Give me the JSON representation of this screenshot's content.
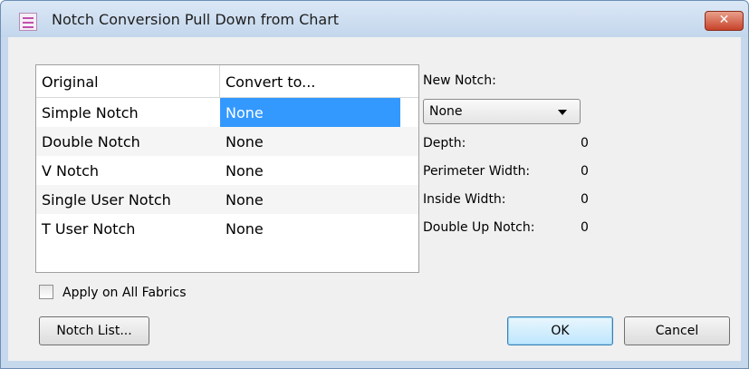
{
  "window": {
    "title": "Notch Conversion Pull Down from Chart",
    "close_label": "✕"
  },
  "grid": {
    "headers": [
      "Original",
      "Convert to..."
    ],
    "rows": [
      {
        "original": "Simple Notch",
        "convert_to": "None"
      },
      {
        "original": "Double Notch",
        "convert_to": "None"
      },
      {
        "original": "V Notch",
        "convert_to": "None"
      },
      {
        "original": "Single User Notch",
        "convert_to": "None"
      },
      {
        "original": "T User Notch",
        "convert_to": "None"
      }
    ]
  },
  "new_notch": {
    "label": "New Notch:",
    "selected": "None",
    "properties": [
      {
        "label": "Depth:",
        "value": "0"
      },
      {
        "label": "Perimeter Width:",
        "value": "0"
      },
      {
        "label": "Inside Width:",
        "value": "0"
      },
      {
        "label": "Double Up Notch:",
        "value": "0"
      }
    ]
  },
  "apply_all": {
    "label": "Apply on All Fabrics",
    "checked": false
  },
  "buttons": {
    "notch_list": "Notch List...",
    "ok": "OK",
    "cancel": "Cancel"
  },
  "colors": {
    "selection": "#3399ff",
    "titlebar": "#c6d8ec",
    "close": "#c7432a"
  }
}
